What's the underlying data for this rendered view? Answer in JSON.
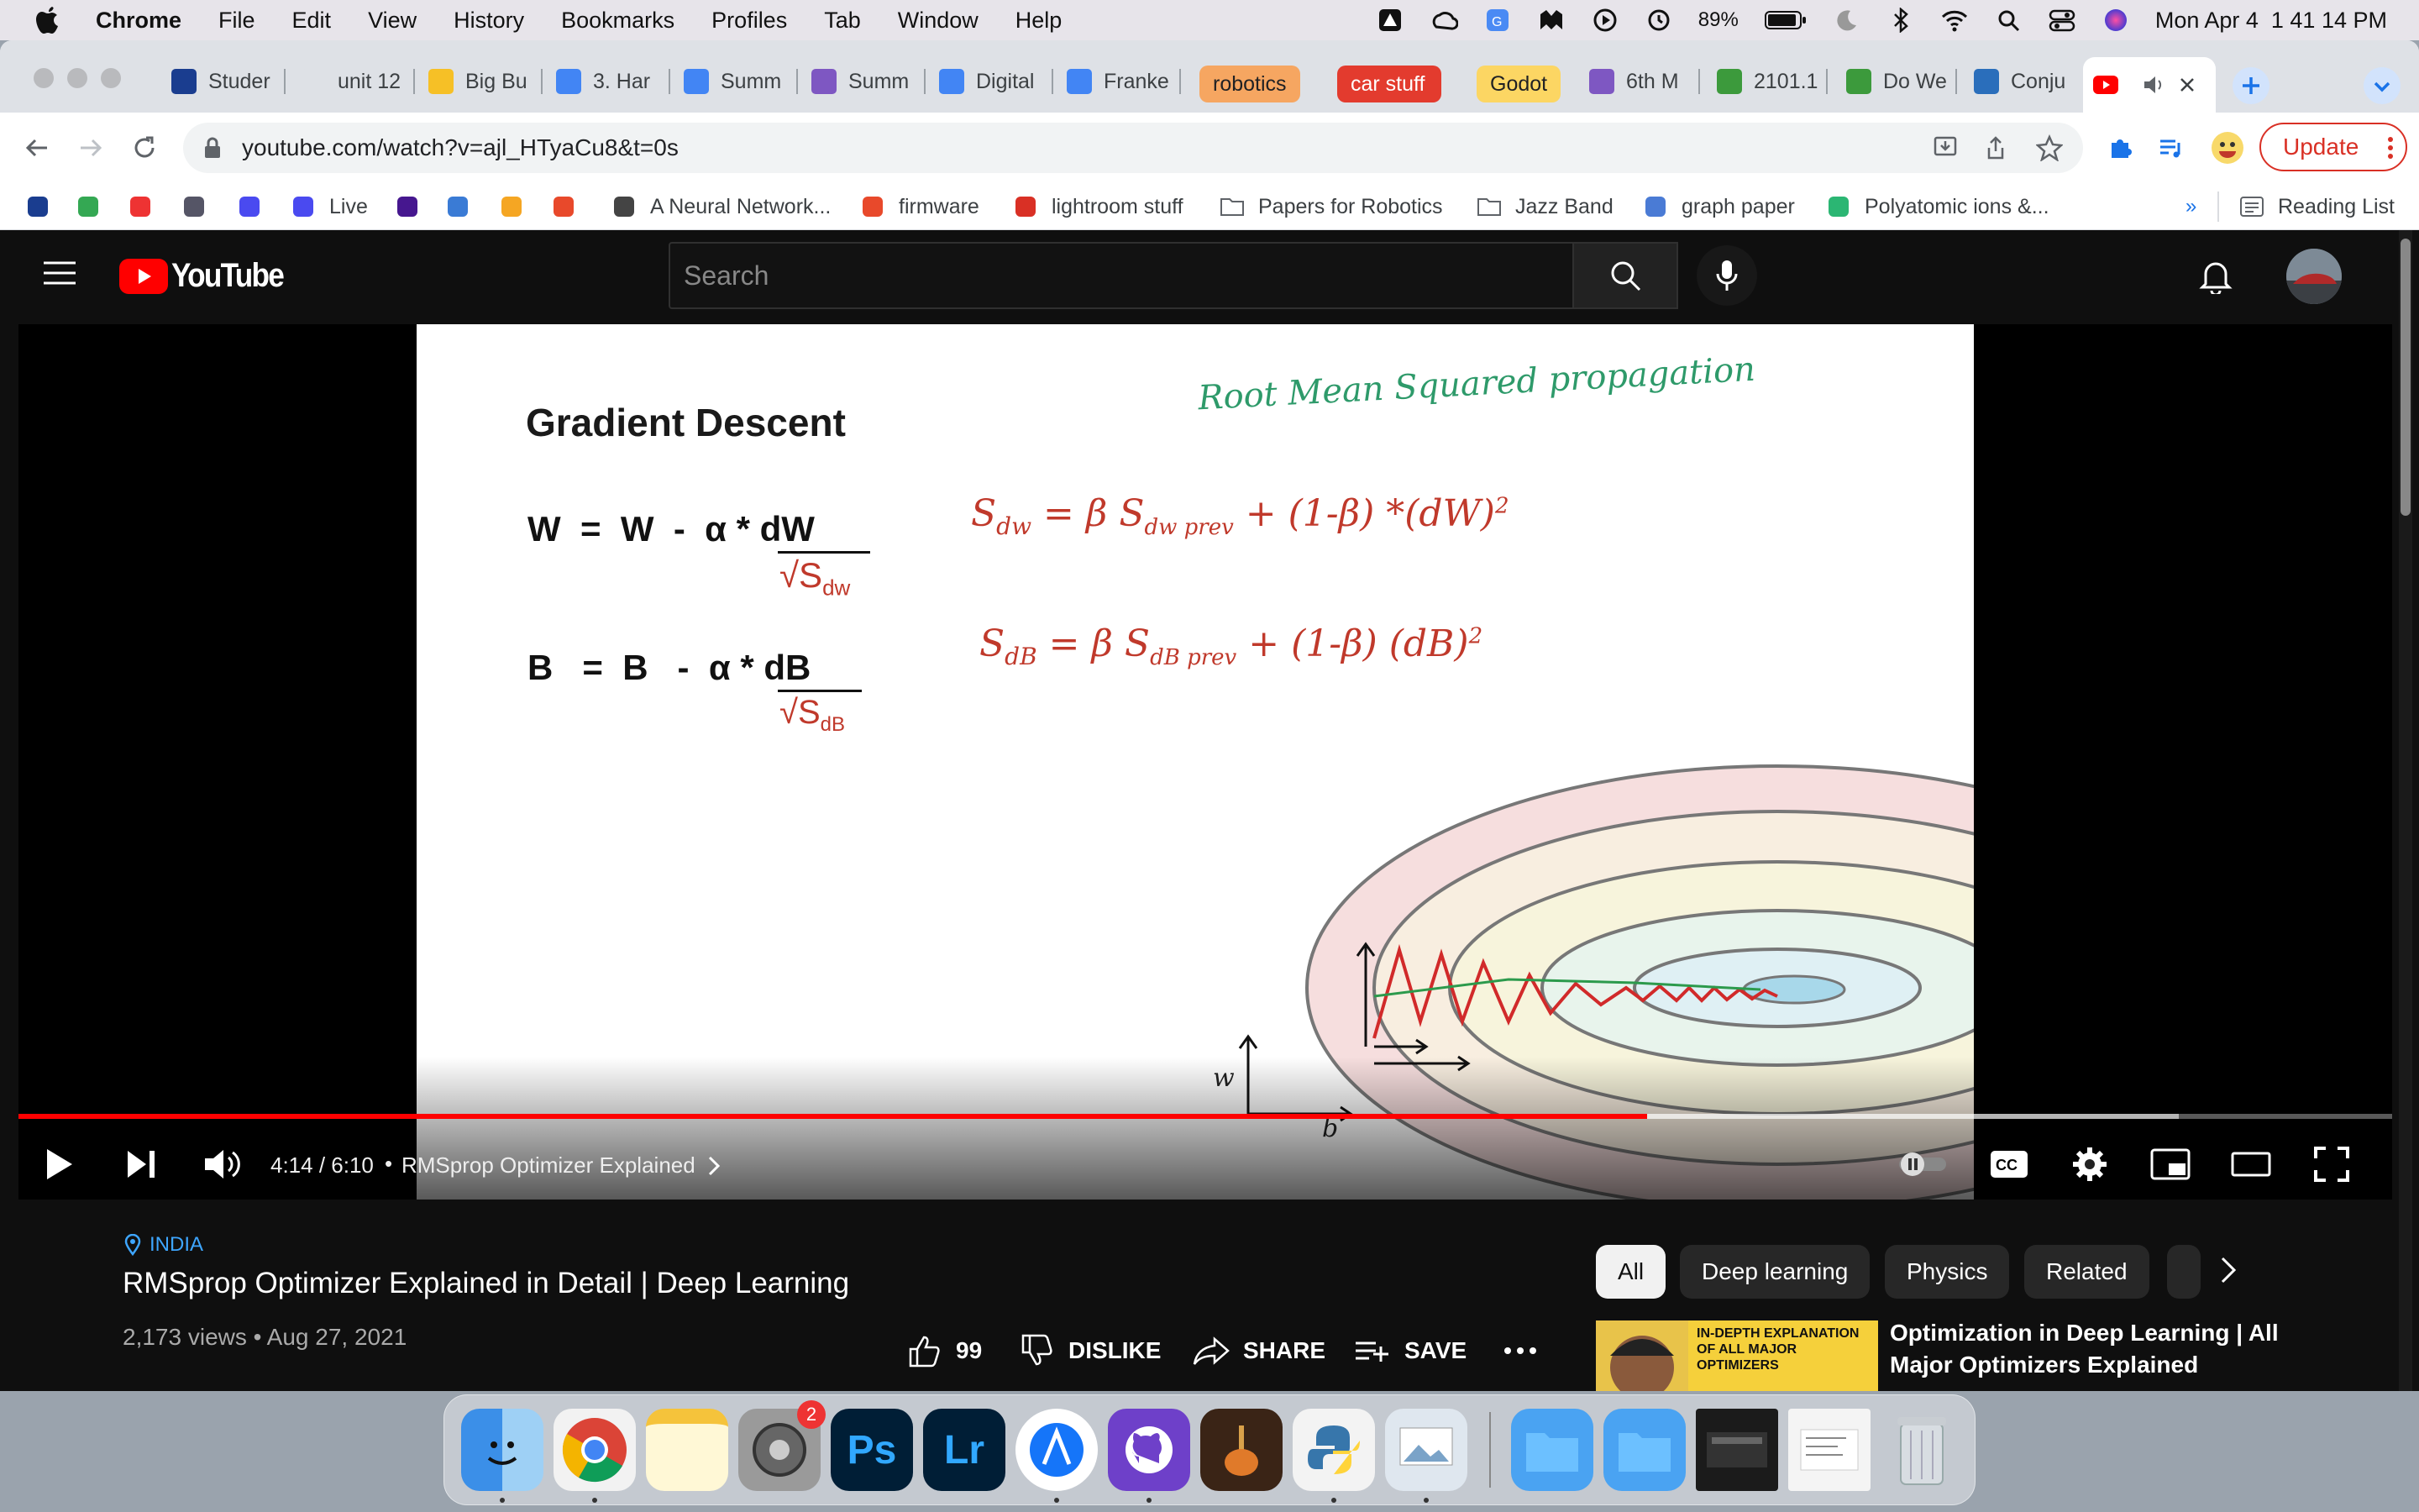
{
  "menubar": {
    "app": "Chrome",
    "items": [
      "File",
      "Edit",
      "View",
      "History",
      "Bookmarks",
      "Profiles",
      "Tab",
      "Window",
      "Help"
    ],
    "battery": "89%",
    "clock": "Mon Apr 4  1 41 14 PM"
  },
  "tabs": [
    {
      "title": "Studer",
      "color": "#1a3d8f"
    },
    {
      "title": "unit 12",
      "color": "#dee1e6"
    },
    {
      "title": "Big Bu",
      "color": "#f6c026"
    },
    {
      "title": "3. Har",
      "color": "#4285f4"
    },
    {
      "title": "Summ",
      "color": "#4285f4"
    },
    {
      "title": "Summ",
      "color": "#7e57c2"
    },
    {
      "title": "Digital",
      "color": "#4285f4"
    },
    {
      "title": "Franke",
      "color": "#4285f4"
    }
  ],
  "tabgroups": [
    {
      "label": "robotics",
      "bg": "#f6a661",
      "fg": "#202124"
    },
    {
      "label": "car stuff",
      "bg": "#e33b2e",
      "fg": "#ffffff"
    },
    {
      "label": "Godot",
      "bg": "#fcd663",
      "fg": "#202124"
    }
  ],
  "tabs2": [
    {
      "title": "6th M",
      "color": "#7e57c2"
    },
    {
      "title": "2101.1",
      "color": "#3c9a3c"
    },
    {
      "title": "Do We",
      "color": "#3c9a3c"
    },
    {
      "title": "Conju",
      "color": "#2a6ebb"
    }
  ],
  "address": {
    "url": "youtube.com/watch?v=ajl_HTyaCu8&t=0s"
  },
  "update_label": "Update",
  "bookmarks": [
    {
      "label": "",
      "icon": "unit-logo-icon"
    },
    {
      "label": "",
      "icon": "drive-icon"
    },
    {
      "label": "",
      "icon": "pulse-icon"
    },
    {
      "label": "",
      "icon": "eye-icon"
    },
    {
      "label": "",
      "icon": "q-icon"
    },
    {
      "label": "Live",
      "icon": "q-live-icon"
    },
    {
      "label": "",
      "icon": "kahoot-icon"
    },
    {
      "label": "",
      "icon": "bug-icon"
    },
    {
      "label": "",
      "icon": "bolt-icon"
    },
    {
      "label": "",
      "icon": "camera-icon"
    },
    {
      "label": "A Neural Network...",
      "icon": "spiral-icon"
    },
    {
      "label": "firmware",
      "icon": "firmware-icon"
    },
    {
      "label": "lightroom stuff",
      "icon": "adobe-icon"
    },
    {
      "label": "Papers for Robotics",
      "icon": "folder-icon"
    },
    {
      "label": "Jazz Band",
      "icon": "folder-icon"
    },
    {
      "label": "graph paper",
      "icon": "globe-icon"
    },
    {
      "label": "Polyatomic ions &...",
      "icon": "check-icon"
    }
  ],
  "reading_list": "Reading List",
  "youtube": {
    "logo_text": "YouTube",
    "search_placeholder": "Search"
  },
  "slide": {
    "heading": "Gradient Descent",
    "handwritten_title": "Root Mean Squared propagation",
    "eq_w": "W  =  W  -  α * dW",
    "eq_w_den": "√S",
    "eq_w_den_sub": "dw",
    "eq_b": "B   =  B   -  α * dB",
    "eq_b_den": "√S",
    "eq_b_den_sub": "dB",
    "hand_sdw": "S",
    "hand_sdw_sub": "dw",
    "hand_sdw_rhs": "=  β S",
    "hand_sdw_prev": "dw prev",
    "hand_sdw_rest": "+  (1-β) *(dW)",
    "hand_sdb": "S",
    "hand_sdb_sub": "dB",
    "hand_sdb_rhs": "=  β S",
    "hand_sdb_prev": "dB prev",
    "hand_sdb_rest": "+  (1-β) (dB)",
    "sq": "2",
    "axis_w": "w",
    "axis_b": "b"
  },
  "player": {
    "time": "4:14 / 6:10",
    "chapter": "RMSprop Optimizer Explained",
    "played_fraction": 0.686,
    "loaded_fraction": 0.91,
    "cc": "CC"
  },
  "video": {
    "location": "INDIA",
    "title": "RMSprop Optimizer Explained in Detail | Deep Learning",
    "meta": "2,173 views • Aug 27, 2021",
    "likes": "99",
    "dislike": "DISLIKE",
    "share": "SHARE",
    "save": "SAVE"
  },
  "chips": [
    "All",
    "Deep learning",
    "Physics",
    "Related"
  ],
  "recommended": {
    "thumb_text": "IN-DEPTH EXPLANATION OF ALL MAJOR OPTIMIZERS",
    "title": "Optimization in Deep Learning | All Major Optimizers Explained"
  },
  "dock": {
    "badge": "2",
    "apps": [
      "finder",
      "chrome",
      "notes",
      "system-preferences",
      "photoshop",
      "lightroom",
      "xcode",
      "github-desktop",
      "garageband",
      "python",
      "preview",
      "downloads-folder",
      "documents-folder",
      "screenshot-1",
      "screenshot-2",
      "trash"
    ],
    "ps_label": "Ps",
    "lr_label": "Lr"
  }
}
